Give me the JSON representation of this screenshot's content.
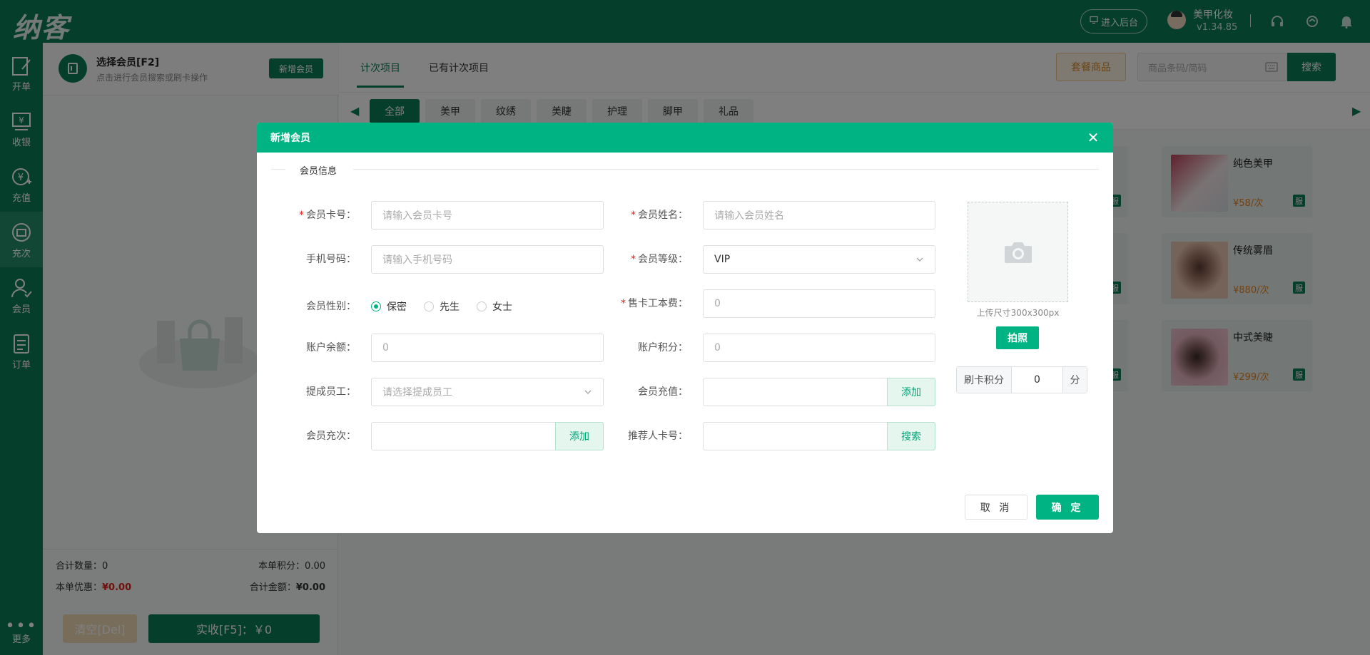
{
  "app": {
    "logo": "纳客",
    "backend_button": "进入后台",
    "user_name": "美甲化妆",
    "version": "v1.34.85"
  },
  "nav": {
    "items": [
      {
        "label": "开单",
        "icon": "edit-icon"
      },
      {
        "label": "收银",
        "icon": "cashier-icon"
      },
      {
        "label": "充值",
        "icon": "recharge-icon"
      },
      {
        "label": "充次",
        "icon": "times-recharge-icon"
      },
      {
        "label": "会员",
        "icon": "member-icon"
      },
      {
        "label": "订单",
        "icon": "order-icon"
      }
    ],
    "active": "充次",
    "more": "更多"
  },
  "member": {
    "title": "选择会员[F2]",
    "subtitle": "点击进行会员搜索或刷卡操作",
    "new_button": "新增会员"
  },
  "summary": {
    "count_label": "合计数量：",
    "count_value": "0",
    "points_label": "本单积分：",
    "points_value": "0.00",
    "discount_label": "本单优惠：",
    "discount_value": "¥0.00",
    "total_label": "合计金额：",
    "total_value": "¥0.00",
    "clear_button": "清空[Del]",
    "pay_button": "实收[F5]：￥0"
  },
  "main": {
    "tabs": [
      "计次项目",
      "已有计次项目"
    ],
    "active_tab": "计次项目",
    "package_button": "套餐商品",
    "search_placeholder": "商品条码/简码",
    "search_button": "搜索",
    "categories": [
      "全部",
      "美甲",
      "纹绣",
      "美睫",
      "护理",
      "脚甲",
      "礼品"
    ],
    "active_category": "全部",
    "products": [
      {
        "name": "纯色美甲",
        "price": "¥58/次",
        "tag": "服"
      },
      {
        "name": "传统雾眉",
        "price": "¥880/次",
        "tag": "服"
      },
      {
        "name": "中式美睫",
        "price": "¥299/次",
        "tag": "服"
      }
    ],
    "left_column_tag": "服"
  },
  "modal": {
    "title": "新增会员",
    "section": "会员信息",
    "fields": {
      "card_no": {
        "label": "会员卡号：",
        "placeholder": "请输入会员卡号",
        "required": true
      },
      "name": {
        "label": "会员姓名：",
        "placeholder": "请输入会员姓名",
        "required": true
      },
      "phone": {
        "label": "手机号码：",
        "placeholder": "请输入手机号码"
      },
      "level": {
        "label": "会员等级：",
        "value": "VIP",
        "required": true
      },
      "gender": {
        "label": "会员性别：",
        "options": [
          "保密",
          "先生",
          "女士"
        ],
        "selected": "保密"
      },
      "card_fee": {
        "label": "售卡工本费：",
        "value": "0",
        "required": true
      },
      "balance": {
        "label": "账户余额：",
        "value": "0"
      },
      "points": {
        "label": "账户积分：",
        "value": "0"
      },
      "staff": {
        "label": "提成员工：",
        "placeholder": "请选择提成员工"
      },
      "recharge": {
        "label": "会员充值：",
        "button": "添加"
      },
      "times": {
        "label": "会员充次：",
        "button": "添加"
      },
      "referrer": {
        "label": "推荐人卡号：",
        "button": "搜索"
      }
    },
    "photo_tip": "上传尺寸300x300px",
    "photo_button": "拍照",
    "swipe_points": {
      "label": "刷卡积分",
      "value": "0",
      "unit": "分"
    },
    "cancel_button": "取 消",
    "ok_button": "确 定",
    "accent": "#00b382"
  }
}
